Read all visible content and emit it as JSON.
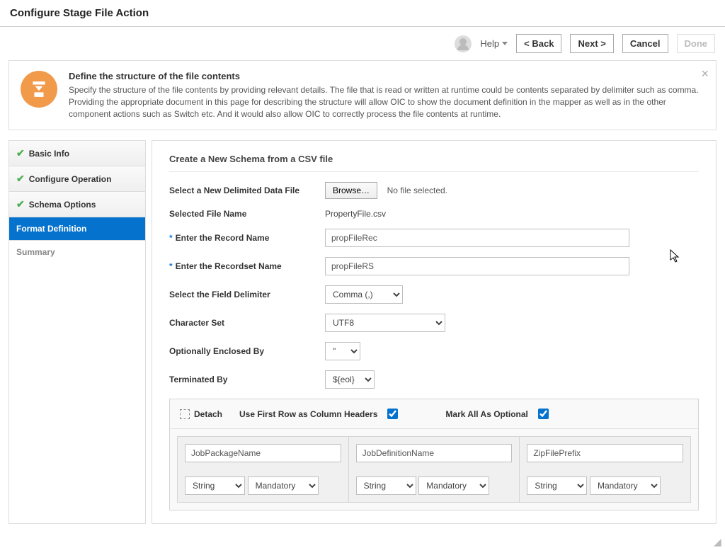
{
  "window": {
    "title": "Configure Stage File Action"
  },
  "topbar": {
    "help": "Help",
    "back": "<  Back",
    "next": "Next  >",
    "cancel": "Cancel",
    "done": "Done"
  },
  "info": {
    "heading": "Define the structure of the file contents",
    "body": "Specify the structure of the file contents by providing relevant details. The file that is read or written at runtime could be contents separated by delimiter such as comma. Providing the appropriate document in this page for describing the structure will allow OIC to show the document definition in the mapper as well as in the other component actions such as Switch etc. And it would also allow OIC to correctly process the file contents at runtime."
  },
  "sidebar": {
    "items": [
      {
        "label": "Basic Info",
        "state": "done"
      },
      {
        "label": "Configure Operation",
        "state": "done"
      },
      {
        "label": "Schema Options",
        "state": "done"
      },
      {
        "label": "Format Definition",
        "state": "active"
      },
      {
        "label": "Summary",
        "state": "muted"
      }
    ]
  },
  "form": {
    "section_title": "Create a New Schema from a CSV file",
    "select_file_label": "Select a New Delimited Data File",
    "browse": "Browse…",
    "no_file": "No file selected.",
    "selected_file_label": "Selected File Name",
    "selected_file_value": "PropertyFile.csv",
    "record_name_label": "Enter the Record Name",
    "record_name_value": "propFileRec",
    "recordset_name_label": "Enter the Recordset Name",
    "recordset_name_value": "propFileRS",
    "delimiter_label": "Select the Field Delimiter",
    "delimiter_value": "Comma (,)",
    "charset_label": "Character Set",
    "charset_value": "UTF8",
    "enclosed_label": "Optionally Enclosed By",
    "enclosed_value": "\"",
    "terminated_label": "Terminated By",
    "terminated_value": "${eol}"
  },
  "grid": {
    "detach": "Detach",
    "use_first_row": "Use First Row as Column Headers",
    "mark_optional": "Mark All As Optional",
    "columns": [
      {
        "name": "JobPackageName",
        "type": "String",
        "mandatory": "Mandatory"
      },
      {
        "name": "JobDefinitionName",
        "type": "String",
        "mandatory": "Mandatory"
      },
      {
        "name": "ZipFilePrefix",
        "type": "String",
        "mandatory": "Mandatory"
      }
    ]
  }
}
